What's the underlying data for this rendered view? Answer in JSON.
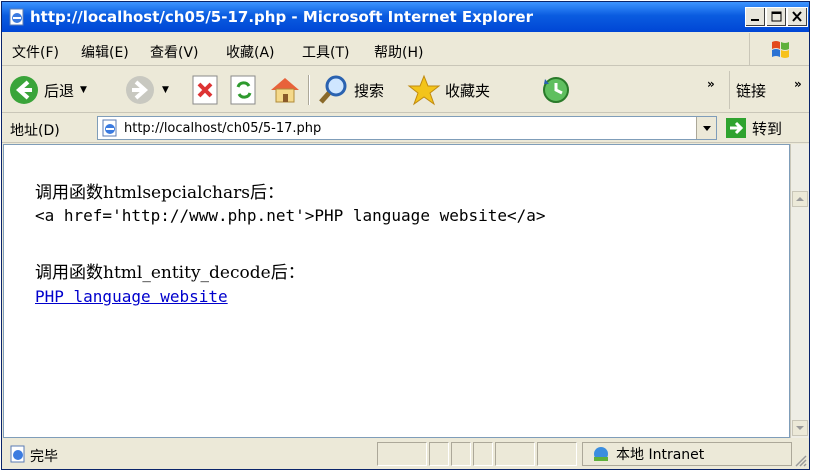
{
  "window": {
    "title": "http://localhost/ch05/5-17.php - Microsoft Internet Explorer"
  },
  "menu": {
    "items": [
      "文件(F)",
      "编辑(E)",
      "查看(V)",
      "收藏(A)",
      "工具(T)",
      "帮助(H)"
    ]
  },
  "toolbar": {
    "back_label": "后退",
    "search_label": "搜索",
    "favorites_label": "收藏夹",
    "links_label": "链接"
  },
  "address": {
    "label": "地址(D)",
    "url": "http://localhost/ch05/5-17.php",
    "go_label": "转到"
  },
  "page": {
    "line1": "调用函数htmlsepcialchars后：",
    "line2": "<a href='http://www.php.net'>PHP language website</a>",
    "line3": "调用函数html_entity_decode后：",
    "link_text": "PHP language website"
  },
  "status": {
    "text": "完毕",
    "zone": "本地 Intranet"
  }
}
